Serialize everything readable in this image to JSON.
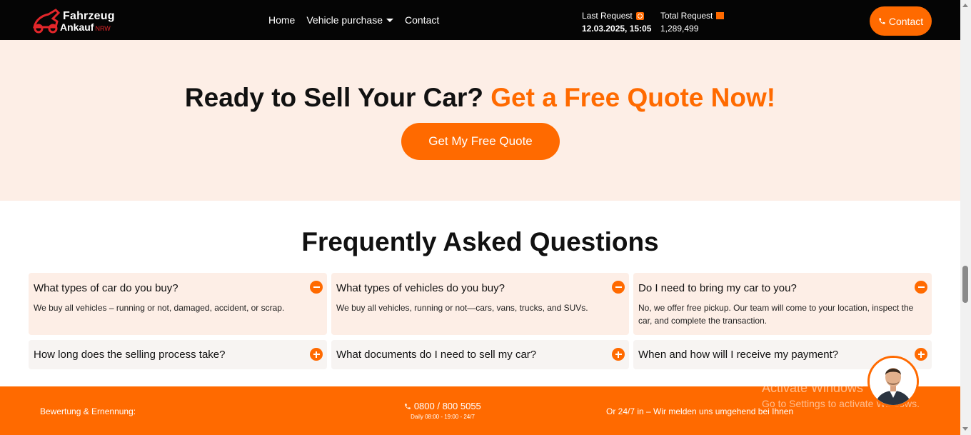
{
  "header": {
    "logo": {
      "line1": "Fahrzeug",
      "line2": "Ankauf",
      "tag": "NRW"
    },
    "nav": [
      {
        "label": "Home"
      },
      {
        "label": "Vehicle purchase"
      },
      {
        "label": "Contact"
      }
    ],
    "last_request": {
      "label": "Last Request",
      "value": "12.03.2025, 15:05"
    },
    "total_request": {
      "label": "Total Request",
      "value": "1,289,499"
    },
    "contact_button": "Contact",
    "accent_color": "#ff6a00"
  },
  "hero": {
    "title_main": "Ready to Sell Your Car?",
    "title_accent": "Get a Free Quote Now!",
    "button": "Get My Free Quote"
  },
  "faq": {
    "title": "Frequently Asked Questions",
    "items": [
      {
        "question": "What types of car do you buy?",
        "answer": "We buy all vehicles – running or not, damaged, accident, or scrap.",
        "expanded": true
      },
      {
        "question": "What types of vehicles do you buy?",
        "answer": "We buy all vehicles, running or not—cars, vans, trucks, and SUVs.",
        "expanded": true
      },
      {
        "question": "Do I need to bring my car to you?",
        "answer": "No, we offer free pickup. Our team will come to your location, inspect the car, and complete the transaction.",
        "expanded": true
      },
      {
        "question": "How long does the selling process take?",
        "answer": "",
        "expanded": false
      },
      {
        "question": "What documents do I need to sell my car?",
        "answer": "",
        "expanded": false
      },
      {
        "question": "When and how will I receive my payment?",
        "answer": "",
        "expanded": false
      }
    ]
  },
  "footer": {
    "left": "Bewertung & Ernennung:",
    "phone": "0800 / 800 5055",
    "hours": "Daily 08:00 - 19:00 - 24/7",
    "right": "Or 24/7 in – Wir melden uns umgehend bei Ihnen"
  },
  "os_overlay": {
    "line1": "Activate Windows",
    "line2": "Go to Settings to activate Windows."
  }
}
